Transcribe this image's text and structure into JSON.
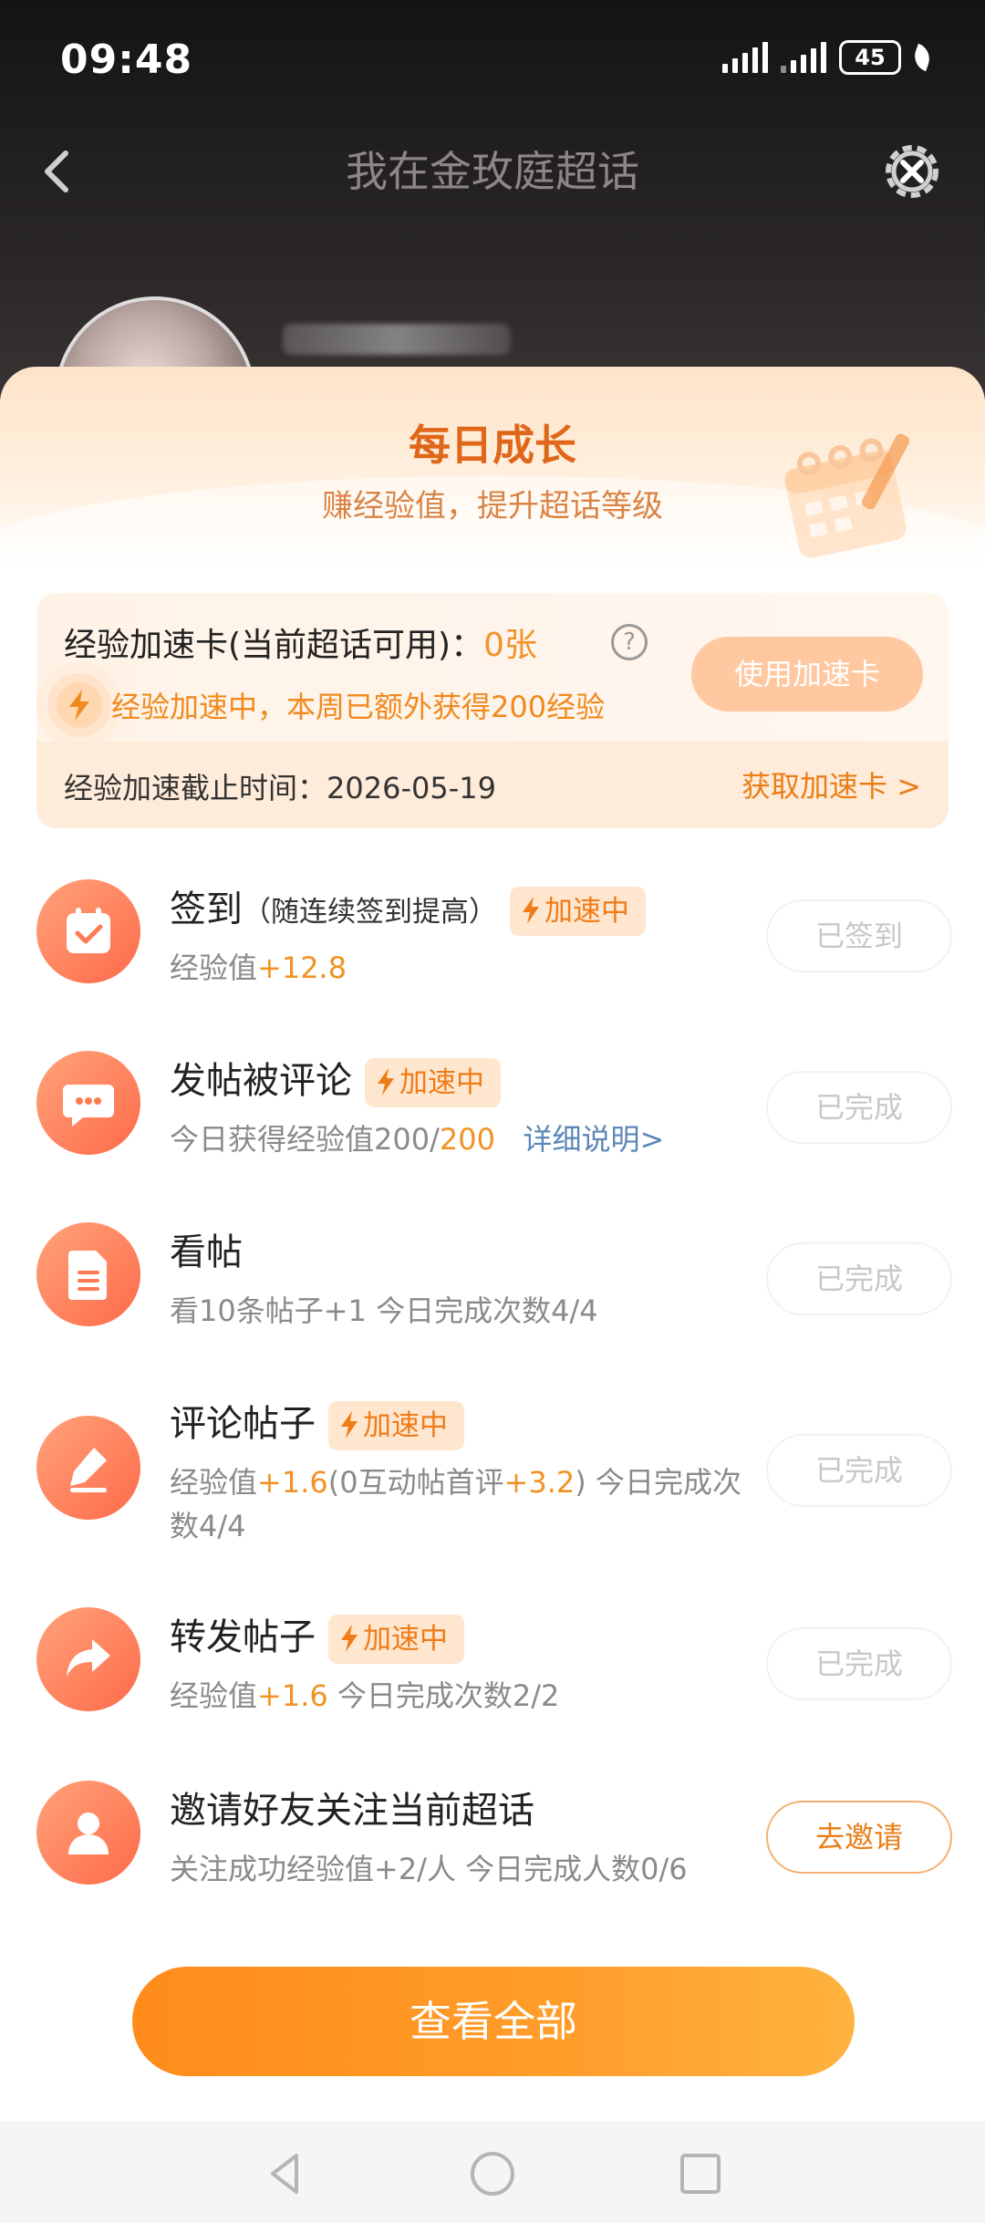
{
  "status_bar": {
    "time": "09:48",
    "battery": "45"
  },
  "nav": {
    "title": "我在金玫庭超话"
  },
  "sheet": {
    "title": "每日成长",
    "subtitle": "赚经验值，提升超话等级"
  },
  "accelerator": {
    "label": "经验加速卡(当前超话可用)：",
    "count": "0张",
    "help": "?",
    "status_note": "经验加速中，本周已额外获得200经验",
    "use_button": "使用加速卡",
    "deadline_label": "经验加速截止时间：",
    "deadline": "2026-05-19",
    "get_link": "获取加速卡",
    "get_link_arrow": ">"
  },
  "accel_tag": "加速中",
  "tasks": [
    {
      "name": "签到",
      "note": "（随连续签到提高）",
      "desc_prefix": "经验值",
      "desc_value": "+12.8",
      "button": "已签到"
    },
    {
      "name": "发帖被评论",
      "desc_prefix": "今日获得经验值200/",
      "desc_value": "200",
      "desc_link": "详细说明>",
      "button": "已完成"
    },
    {
      "name": "看帖",
      "desc": "看10条帖子+1   今日完成次数4/4",
      "button": "已完成"
    },
    {
      "name": "评论帖子",
      "desc_a": "经验值",
      "desc_v1": "+1.6",
      "desc_b": "(0互动帖首评",
      "desc_v2": "+3.2",
      "desc_c": ")   今日完成次",
      "desc_line2": "数4/4",
      "button": "已完成"
    },
    {
      "name": "转发帖子",
      "desc_prefix": "经验值",
      "desc_value": "+1.6",
      "desc_suffix": "   今日完成次数2/2",
      "button": "已完成"
    },
    {
      "name": "邀请好友关注当前超话",
      "desc": "关注成功经验值+2/人   今日完成人数0/6",
      "button": "去邀请"
    }
  ],
  "cta": "查看全部",
  "colors": {
    "accent": "#ff8c1a",
    "highlight": "#f09324",
    "link": "#5c87b8"
  }
}
